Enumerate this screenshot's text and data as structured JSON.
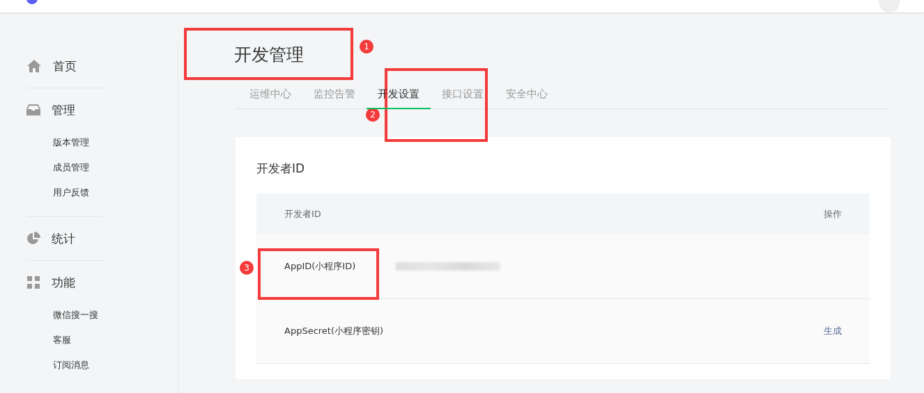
{
  "sidebar": {
    "sections": [
      {
        "kind": "home",
        "label": "首页"
      },
      {
        "kind": "inbox",
        "label": "管理",
        "children": [
          {
            "label": "版本管理"
          },
          {
            "label": "成员管理"
          },
          {
            "label": "用户反馈"
          }
        ]
      },
      {
        "kind": "chart",
        "label": "统计"
      },
      {
        "kind": "grid",
        "label": "功能",
        "children": [
          {
            "label": "微信搜一搜"
          },
          {
            "label": "客服"
          },
          {
            "label": "订阅消息"
          }
        ]
      }
    ]
  },
  "page": {
    "title": "开发管理",
    "annotation": "1"
  },
  "tabs": [
    {
      "label": "运维中心",
      "selected": false
    },
    {
      "label": "监控告警",
      "selected": false
    },
    {
      "label": "开发设置",
      "selected": true,
      "annotation": "2"
    },
    {
      "label": "接口设置",
      "selected": false
    },
    {
      "label": "安全中心",
      "selected": false
    }
  ],
  "card": {
    "title": "开发者ID",
    "table": {
      "columns": [
        "开发者ID",
        "操作"
      ],
      "rows": [
        {
          "name": "AppID(小程序ID)",
          "value_redacted": true,
          "action": null,
          "annotation": "3"
        },
        {
          "name": "AppSecret(小程序密钥)",
          "value_redacted": false,
          "action": "生成"
        }
      ]
    }
  }
}
